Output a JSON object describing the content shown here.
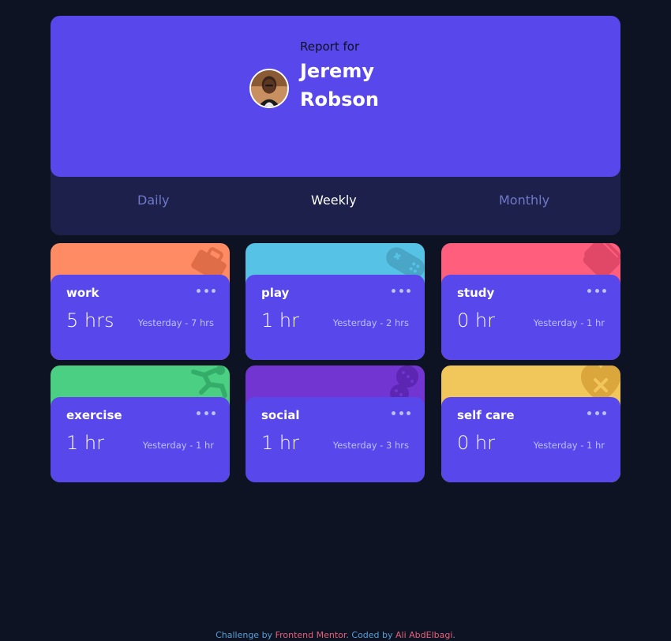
{
  "profile": {
    "report_label": "Report for",
    "user_name": "Jeremy Robson",
    "avatar_alt": "avatar-photo"
  },
  "tabs": [
    {
      "label": "Daily",
      "active": false
    },
    {
      "label": "Weekly",
      "active": true
    },
    {
      "label": "Monthly",
      "active": false
    }
  ],
  "activities": [
    {
      "title": "work",
      "hours": "5 hrs",
      "previous": "Yesterday - 7 hrs",
      "color": "#ff8b64",
      "icon": "briefcase-icon"
    },
    {
      "title": "play",
      "hours": "1 hr",
      "previous": "Yesterday - 2 hrs",
      "color": "#55c2e6",
      "icon": "gamepad-icon"
    },
    {
      "title": "study",
      "hours": "0 hr",
      "previous": "Yesterday - 1 hr",
      "color": "#ff5e7d",
      "icon": "book-icon"
    },
    {
      "title": "exercise",
      "hours": "1 hr",
      "previous": "Yesterday - 1 hr",
      "color": "#4bcf82",
      "icon": "running-person-icon"
    },
    {
      "title": "social",
      "hours": "1 hr",
      "previous": "Yesterday - 3 hrs",
      "color": "#7335d2",
      "icon": "chat-bubbles-icon"
    },
    {
      "title": "self care",
      "hours": "0 hr",
      "previous": "Yesterday - 1 hr",
      "color": "#f1c75b",
      "icon": "heart-icon"
    }
  ],
  "footer": {
    "challenge_prefix": "Challenge by ",
    "challenge_link": "Frontend Mentor",
    "coded_prefix": ". Coded by ",
    "coded_link": "Ali AbdElbagi",
    "suffix": "."
  },
  "colors": {
    "background": "#0e1323",
    "panel": "#1c204b",
    "accent": "#5847eb",
    "muted_text": "#bbc0ff",
    "inactive_tab": "#7078c9"
  }
}
